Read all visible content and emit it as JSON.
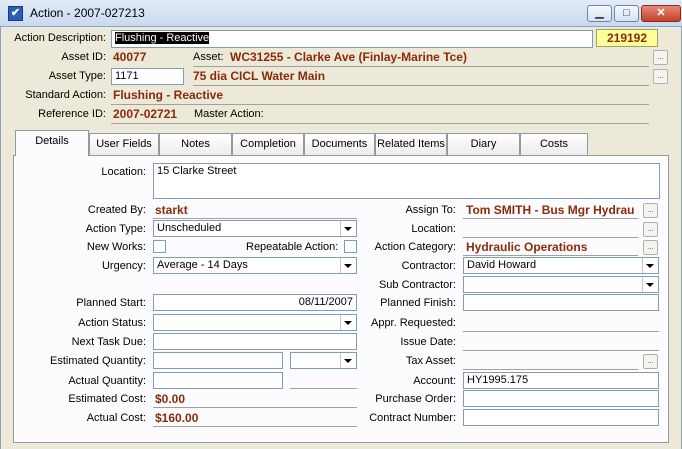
{
  "window": {
    "title": "Action - 2007-027213",
    "minimize": "▁",
    "maximize": "□",
    "close": "✕"
  },
  "header": {
    "action_description_label": "Action Description:",
    "action_description_value": "Flushing - Reactive",
    "record_id": "219192",
    "asset_id_label": "Asset ID:",
    "asset_id_value": "40077",
    "asset_label": "Asset:",
    "asset_value": "WC31255 - Clarke Ave (Finlay-Marine Tce)",
    "asset_type_label": "Asset Type:",
    "asset_type_value": "1171",
    "asset_type_desc": "75 dia CICL Water Main",
    "standard_action_label": "Standard Action:",
    "standard_action_value": "Flushing - Reactive",
    "reference_id_label": "Reference ID:",
    "reference_id_value": "2007-02721",
    "master_action_label": "Master Action:",
    "ellipsis": "..."
  },
  "tabs": [
    "Details",
    "User Fields",
    "Notes",
    "Completion",
    "Documents",
    "Related Items",
    "Diary",
    "Costs"
  ],
  "details": {
    "location_label": "Location:",
    "location_value": "15 Clarke Street",
    "created_by_label": "Created By:",
    "created_by_value": "starkt",
    "action_type_label": "Action Type:",
    "action_type_value": "Unscheduled",
    "new_works_label": "New Works:",
    "repeatable_label": "Repeatable Action:",
    "urgency_label": "Urgency:",
    "urgency_value": "Average - 14 Days",
    "planned_start_label": "Planned Start:",
    "planned_start_value": "08/11/2007",
    "action_status_label": "Action Status:",
    "action_status_value": "",
    "next_task_label": "Next Task Due:",
    "est_qty_label": "Estimated Quantity:",
    "act_qty_label": "Actual Quantity:",
    "est_cost_label": "Estimated Cost:",
    "est_cost_value": "$0.00",
    "act_cost_label": "Actual Cost:",
    "act_cost_value": "$160.00",
    "assign_to_label": "Assign To:",
    "assign_to_value": "Tom SMITH - Bus Mgr Hydrau",
    "location2_label": "Location:",
    "action_category_label": "Action Category:",
    "action_category_value": "Hydraulic Operations",
    "contractor_label": "Contractor:",
    "contractor_value": "David Howard",
    "sub_contractor_label": "Sub Contractor:",
    "planned_finish_label": "Planned Finish:",
    "appr_requested_label": "Appr. Requested:",
    "issue_date_label": "Issue Date:",
    "tax_asset_label": "Tax Asset:",
    "account_label": "Account:",
    "account_value": "HY1995.175",
    "purchase_order_label": "Purchase Order:",
    "contract_number_label": "Contract Number:"
  }
}
